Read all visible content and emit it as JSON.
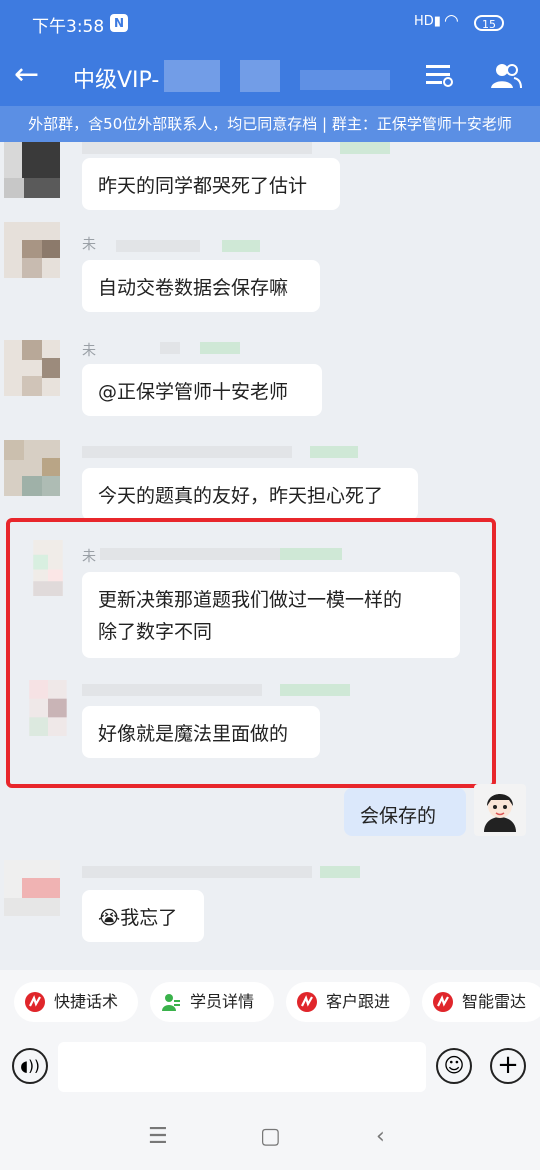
{
  "status_bar": {
    "time": "下午3:58",
    "notif_badge": "N",
    "signal": "HD",
    "wifi": "WiFi",
    "battery": "15"
  },
  "header": {
    "title": "中级VIP-"
  },
  "info_banner": "外部群，含50位外部联系人，均已同意存档 | 群主：正保学管师十安老师",
  "messages": {
    "m1": {
      "text": "昨天的同学都哭死了估计"
    },
    "m2": {
      "name": "未",
      "text": "自动交卷数据会保存嘛"
    },
    "m3": {
      "name": "未",
      "text": "@正保学管师十安老师"
    },
    "m4": {
      "name": "未",
      "text": "今天的题真的友好，昨天担心死了"
    },
    "m5": {
      "name": "未",
      "text_line1": "更新决策那道题我们做过一模一样的",
      "text_line2": "除了数字不同"
    },
    "m6": {
      "text": "好像就是魔法里面做的"
    },
    "m7": {
      "text": "会保存的"
    },
    "m8": {
      "emoji": "😭",
      "text": "我忘了"
    }
  },
  "quick_actions": [
    "快捷话术",
    "学员详情",
    "客户跟进",
    "智能雷达"
  ],
  "colors": {
    "header": "#3e7be0",
    "banner": "#5b8fe4",
    "highlight": "#e8262b",
    "chip_icon": "#e0262b",
    "chip_icon_green": "#3ab24b"
  },
  "icons": {
    "back": "arrow-left-icon",
    "menu": "menu-toggle-icon",
    "members": "members-icon",
    "voice": "voice-icon",
    "emoji": "emoji-icon",
    "plus": "plus-icon"
  }
}
